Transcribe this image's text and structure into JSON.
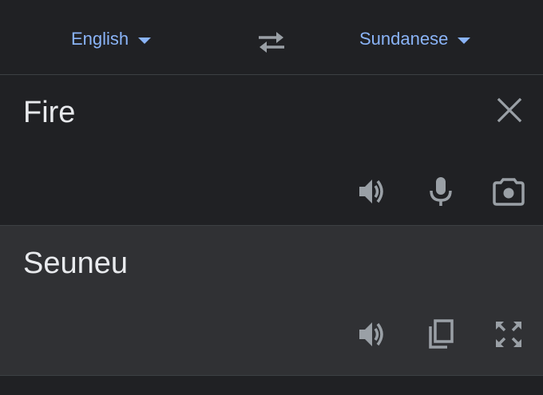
{
  "language_bar": {
    "source_language": "English",
    "target_language": "Sundanese"
  },
  "source": {
    "text": "Fire"
  },
  "translation": {
    "text": "Seuneu"
  },
  "icons": {
    "swap": "swap-icon",
    "clear": "close-icon",
    "listen_source": "speaker-icon",
    "voice_input": "microphone-icon",
    "camera": "camera-icon",
    "listen_translation": "speaker-icon",
    "copy": "copy-icon",
    "fullscreen": "fullscreen-icon"
  },
  "colors": {
    "background": "#202124",
    "result_background": "#303134",
    "accent": "#8ab4f8",
    "text": "#e8eaed",
    "icon": "#9aa0a6"
  }
}
